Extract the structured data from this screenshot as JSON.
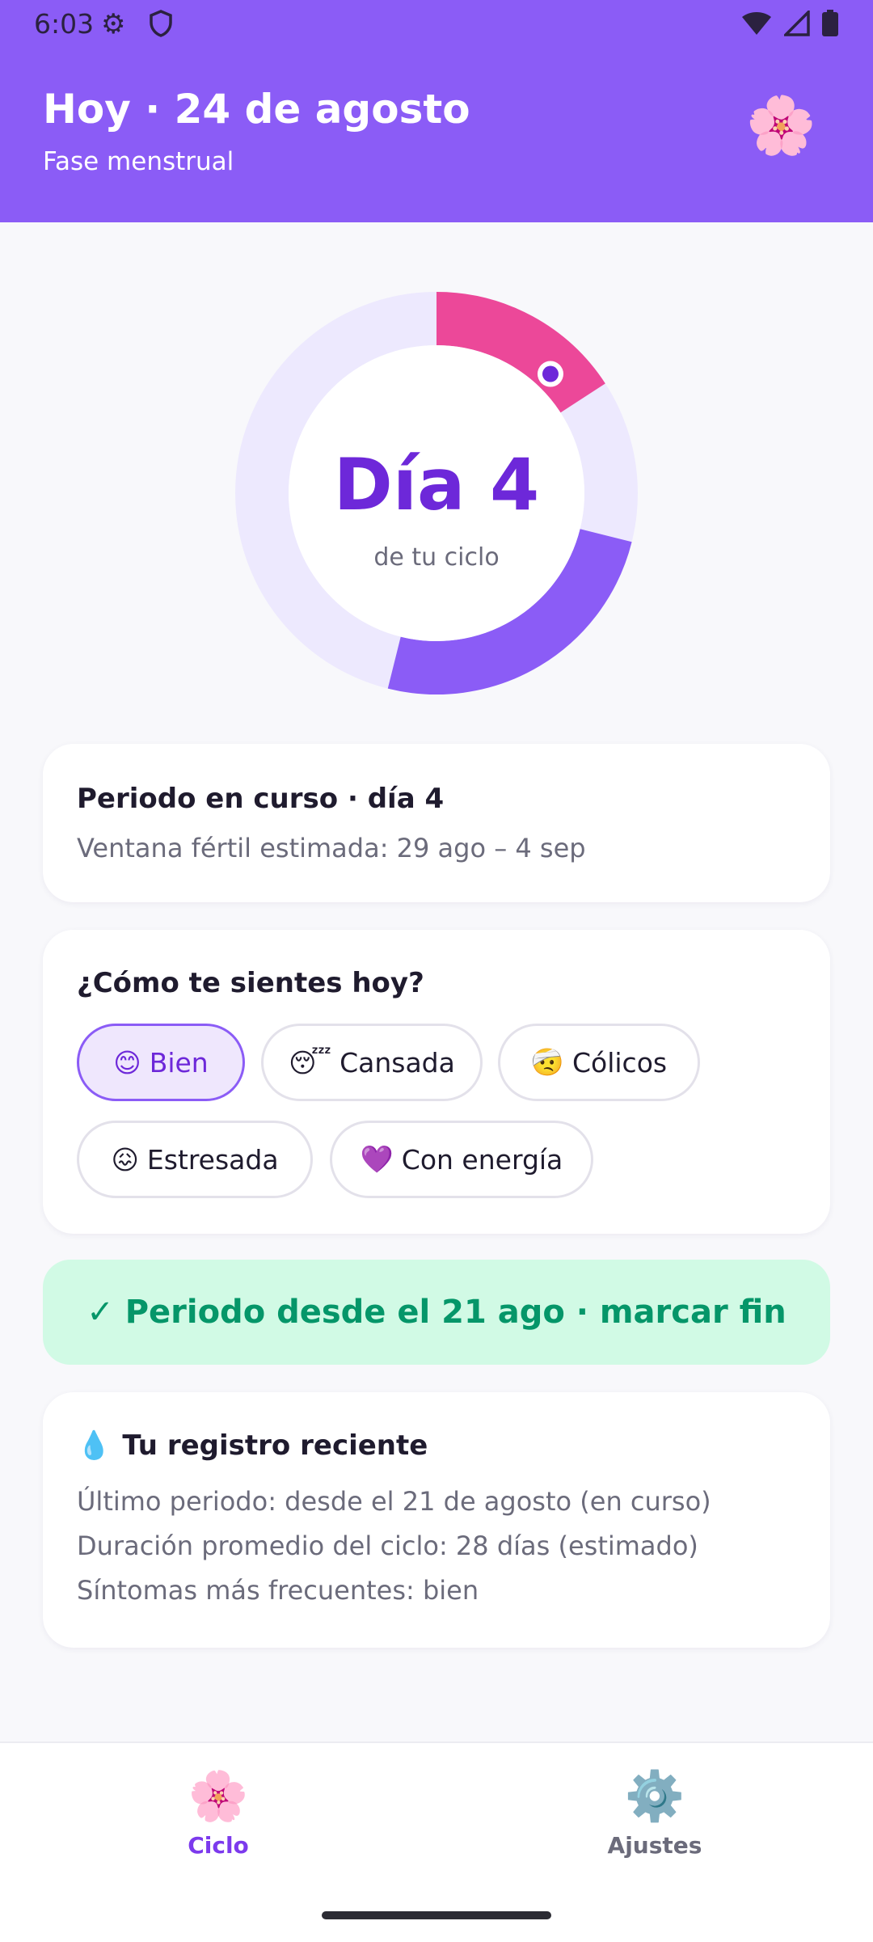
{
  "status": {
    "time": "6:03",
    "icons": [
      "gear-icon",
      "shield-icon",
      "wifi-icon",
      "signal-icon",
      "battery-icon"
    ]
  },
  "header": {
    "title": "Hoy · 24 de agosto",
    "subtitle": "Fase menstrual",
    "icon": "flower-icon",
    "bg_color": "#8b5cf6"
  },
  "ring": {
    "day_label": "Día 4",
    "caption": "de tu ciclo",
    "cycle_length_days": 28,
    "current_day": 4
  },
  "period_card": {
    "title": "Periodo en curso · día 4",
    "subtitle": "Ventana fértil estimada: 29 ago – 4 sep"
  },
  "mood": {
    "title": "¿Cómo te sientes hoy?",
    "options": [
      {
        "emoji": "😊",
        "label": "Bien",
        "selected": true
      },
      {
        "emoji": "😴",
        "label": "Cansada",
        "selected": false
      },
      {
        "emoji": "🤕",
        "label": "Cólicos",
        "selected": false
      },
      {
        "emoji": "😖",
        "label": "Estresada",
        "selected": false
      },
      {
        "emoji": "💜",
        "label": "Con energía",
        "selected": false
      }
    ]
  },
  "banner": {
    "label": "✓ Periodo desde el 21 ago · marcar fin"
  },
  "recent": {
    "icon": "💧",
    "title": "Tu registro reciente",
    "lines": [
      "Último periodo: desde el 21 de agosto (en curso)",
      "Duración promedio del ciclo: 28 días (estimado)",
      "Síntomas más frecuentes: bien"
    ]
  },
  "nav": {
    "items": [
      {
        "icon": "🌸",
        "label": "Ciclo",
        "active": true
      },
      {
        "icon": "⚙️",
        "label": "Ajustes",
        "active": false
      }
    ]
  },
  "colors": {
    "accent": "#8b5cf6",
    "accent_dark": "#6d28d9",
    "period_pink": "#ec4899",
    "ring_track": "#ede9fe",
    "success_bg": "#d1fae5",
    "success_text": "#059669"
  }
}
